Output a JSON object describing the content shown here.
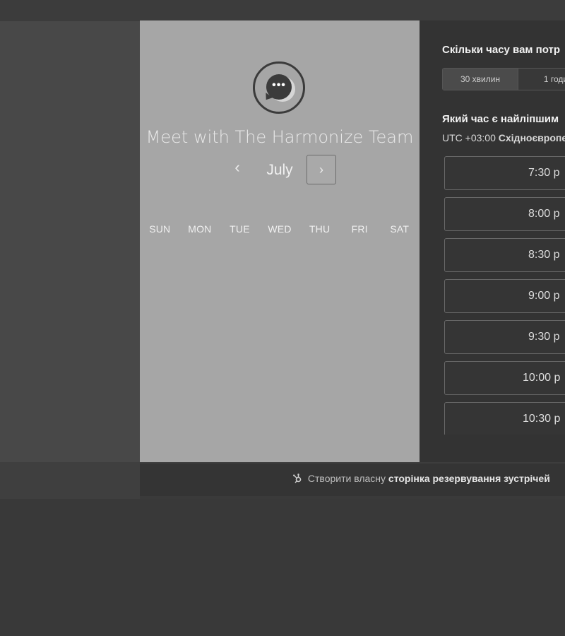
{
  "host": {
    "title": "Meet with The Harmonize Team",
    "avatar_icon": "chat-bubble-icon",
    "avatar_glyph": "•••"
  },
  "calendar": {
    "prev_label": "‹",
    "month": "July",
    "next_label": "›",
    "weekdays": [
      "SUN",
      "MON",
      "TUE",
      "WED",
      "THU",
      "FRI",
      "SAT"
    ]
  },
  "booking": {
    "duration_question": "Скільки часу вам потр",
    "durations": [
      "30 хвилин",
      "1 годи"
    ],
    "time_question": "Який час є найліпшим",
    "timezone_offset": "UTC +03:00",
    "timezone_name": "Східноєвропе",
    "slots": [
      "7:30 p",
      "8:00 p",
      "8:30 p",
      "9:00 p",
      "9:30 p",
      "10:00 p",
      "10:30 p"
    ]
  },
  "footer": {
    "icon": "hubspot-sprocket-icon",
    "prefix": "Створити власну",
    "link": "сторінка резервування зустрічей"
  },
  "colors": {
    "card_bg": "#a6a6a6",
    "panel_bg": "#333333",
    "page_bg": "#3a3a3a"
  }
}
